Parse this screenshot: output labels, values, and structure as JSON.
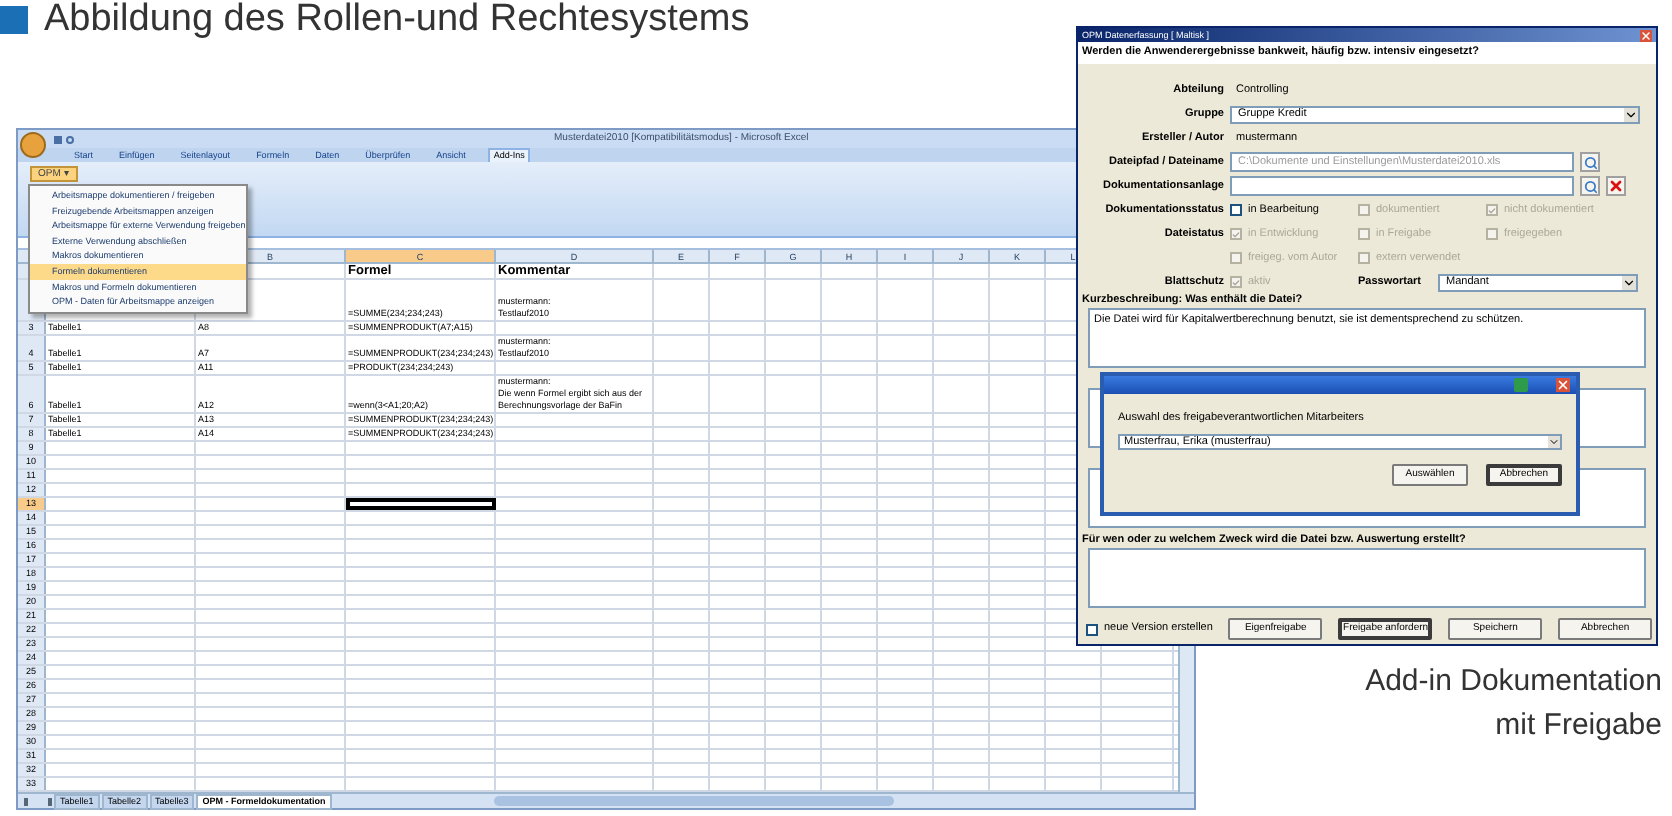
{
  "heading": {
    "text": "Abbildung des Rollen-und Rechtesystems"
  },
  "excel": {
    "title": "Musterdatei2010 [Kompatibilitätsmodus] - Microsoft Excel",
    "ribbon_tabs": [
      {
        "label": "Start",
        "selected": false
      },
      {
        "label": "Einfügen",
        "selected": false
      },
      {
        "label": "Seitenlayout",
        "selected": false
      },
      {
        "label": "Formeln",
        "selected": false
      },
      {
        "label": "Daten",
        "selected": false
      },
      {
        "label": "Überprüfen",
        "selected": false
      },
      {
        "label": "Ansicht",
        "selected": false
      },
      {
        "label": "Add-Ins",
        "selected": true
      }
    ],
    "addin_button": "OPM ▾",
    "menu": [
      {
        "label": "Arbeitsmappe dokumentieren / freigeben",
        "selected": false
      },
      {
        "label": "Freizugebende Arbeitsmappen anzeigen",
        "selected": false
      },
      {
        "label": "Arbeitsmappe für externe Verwendung freigeben",
        "selected": false
      },
      {
        "label": "Externe Verwendung abschließen",
        "selected": false
      },
      {
        "label": "Makros dokumentieren",
        "selected": false
      },
      {
        "label": "Formeln dokumentieren",
        "selected": true
      },
      {
        "label": "Makros und Formeln dokumentieren",
        "selected": false
      },
      {
        "label": "OPM - Daten für Arbeitsmappe anzeigen",
        "selected": false
      }
    ],
    "columns": [
      {
        "label": "B",
        "selected": false
      },
      {
        "label": "C",
        "selected": true
      },
      {
        "label": "D",
        "selected": false
      },
      {
        "label": "E",
        "selected": false
      },
      {
        "label": "F",
        "selected": false
      },
      {
        "label": "G",
        "selected": false
      },
      {
        "label": "H",
        "selected": false
      },
      {
        "label": "I",
        "selected": false
      },
      {
        "label": "J",
        "selected": false
      },
      {
        "label": "K",
        "selected": false
      },
      {
        "label": "L",
        "selected": false
      }
    ],
    "rows": [
      {
        "selected": false,
        "c": "Formel",
        "d": "Kommentar"
      },
      {
        "selected": false,
        "c": "=SUMME(234;234;243)",
        "d": "mustermann:\nTestlauf2010"
      },
      {
        "number": "3",
        "selected": false,
        "a": "Tabelle1",
        "b": "A8",
        "c": "=SUMMENPRODUKT(A7;A15)"
      },
      {
        "number": "4",
        "selected": false,
        "a": "Tabelle1",
        "b": "A7",
        "c": "=SUMMENPRODUKT(234;234;243)",
        "d": "mustermann:\nTestlauf2010"
      },
      {
        "number": "5",
        "selected": false,
        "a": "Tabelle1",
        "b": "A11",
        "c": "=PRODUKT(234;234;243)"
      },
      {
        "number": "6",
        "selected": false,
        "a": "Tabelle1",
        "b": "A12",
        "c": "=wenn(3<A1;20;A2)",
        "d": "mustermann:\nDie wenn Formel ergibt sich aus der Berechnungsvorlage der BaFin"
      },
      {
        "number": "7",
        "selected": false,
        "a": "Tabelle1",
        "b": "A13",
        "c": "=SUMMENPRODUKT(234;234;243)"
      },
      {
        "number": "8",
        "selected": false,
        "a": "Tabelle1",
        "b": "A14",
        "c": "=SUMMENPRODUKT(234;234;243)"
      },
      {
        "number": "9",
        "selected": false
      },
      {
        "number": "10",
        "selected": false
      },
      {
        "number": "11",
        "selected": false
      },
      {
        "number": "12",
        "selected": false
      },
      {
        "number": "13",
        "selected": true
      },
      {
        "number": "14",
        "selected": false
      },
      {
        "number": "15",
        "selected": false
      },
      {
        "number": "16",
        "selected": false
      },
      {
        "number": "17",
        "selected": false
      },
      {
        "number": "18",
        "selected": false
      },
      {
        "number": "19",
        "selected": false
      },
      {
        "number": "20",
        "selected": false
      },
      {
        "number": "21",
        "selected": false
      },
      {
        "number": "22",
        "selected": false
      },
      {
        "number": "23",
        "selected": false
      },
      {
        "number": "24",
        "selected": false
      },
      {
        "number": "25",
        "selected": false
      },
      {
        "number": "26",
        "selected": false
      },
      {
        "number": "27",
        "selected": false
      },
      {
        "number": "28",
        "selected": false
      },
      {
        "number": "29",
        "selected": false
      },
      {
        "number": "30",
        "selected": false
      },
      {
        "number": "31",
        "selected": false
      },
      {
        "number": "32",
        "selected": false
      },
      {
        "number": "33",
        "selected": false
      }
    ],
    "sheet_tabs": [
      {
        "label": "Tabelle1",
        "selected": false
      },
      {
        "label": "Tabelle2",
        "selected": false
      },
      {
        "label": "Tabelle3",
        "selected": false
      },
      {
        "label": "OPM - Formeldokumentation",
        "selected": true
      }
    ]
  },
  "dialog": {
    "title": "OPM Datenerfassung [ Maltisk ]",
    "question": "Werden die Anwenderergebnisse bankweit, häufig bzw. intensiv eingesetzt?",
    "fields": [
      {
        "kind": "text",
        "label": "Abteilung",
        "value": "Controlling"
      },
      {
        "kind": "select",
        "label": "Gruppe",
        "value": "Gruppe Kredit"
      },
      {
        "kind": "text",
        "label": "Ersteller / Autor",
        "value": "mustermann"
      },
      {
        "kind": "path",
        "label": "Dateipfad / Dateiname",
        "value": "C:\\Dokumente und Einstellungen\\Musterdatei2010.xls",
        "disabled": true
      },
      {
        "kind": "attachment",
        "label": "Dokumentationsanlage"
      }
    ],
    "status_groups": [
      {
        "label": "Dokumentationsstatus",
        "options": [
          {
            "label": "in Bearbeitung",
            "checked": false,
            "disabled": false
          },
          {
            "label": "dokumentiert",
            "checked": false,
            "disabled": true
          },
          {
            "label": "nicht dokumentiert",
            "checked": true,
            "disabled": true
          }
        ]
      },
      {
        "label": "Dateistatus",
        "options": [
          {
            "label": "in Entwicklung",
            "checked": true,
            "disabled": true
          },
          {
            "label": "in Freigabe",
            "checked": false,
            "disabled": true
          },
          {
            "label": "freigegeben",
            "checked": false,
            "disabled": true
          }
        ]
      },
      {
        "options": [
          {
            "label": "freigeg. vom Autor",
            "checked": false,
            "disabled": true
          },
          {
            "label": "extern verwendet",
            "checked": false,
            "disabled": true
          }
        ]
      }
    ],
    "protection": {
      "label": "Blattschutz",
      "option": {
        "label": "aktiv",
        "checked": true,
        "disabled": true
      },
      "password_label": "Passwortart",
      "password_value": "Mandant"
    },
    "text_areas": [
      {
        "kind": "labeled",
        "label": "Kurzbeschreibung: Was enthält die Datei?",
        "value": "Die Datei wird für Kapitalwertberechnung benutzt, sie ist dementsprechend zu schützen."
      },
      {
        "kind": "covered"
      },
      {
        "kind": "covered"
      },
      {
        "kind": "labeled",
        "label": "Für wen oder zu welchem Zweck wird die Datei bzw. Auswertung erstellt?"
      }
    ],
    "new_version": {
      "label": "neue Version erstellen",
      "checked": false
    },
    "buttons": [
      {
        "label": "Eigenfreigabe",
        "default": false
      },
      {
        "label": "Freigabe anfordern",
        "default": true
      },
      {
        "label": "Speichern",
        "default": false
      },
      {
        "label": "Abbrechen",
        "default": false
      }
    ]
  },
  "popup": {
    "prompt": "Auswahl des freigabeverantwortlichen Mitarbeiters",
    "value": "Musterfrau, Erika (musterfrau)",
    "buttons": [
      {
        "label": "Auswählen",
        "default": false
      },
      {
        "label": "Abbrechen",
        "default": true
      }
    ]
  },
  "caption": "Add-in Dokumentation mit Freigabe"
}
